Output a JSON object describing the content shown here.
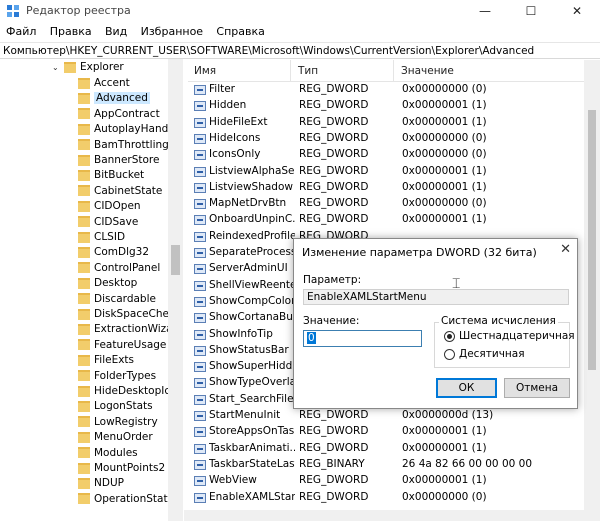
{
  "window": {
    "title": "Редактор реестра",
    "minimize": "—",
    "maximize": "☐",
    "close": "✕"
  },
  "menu": [
    "Файл",
    "Правка",
    "Вид",
    "Избранное",
    "Справка"
  ],
  "address": "Компьютер\\HKEY_CURRENT_USER\\SOFTWARE\\Microsoft\\Windows\\CurrentVersion\\Explorer\\Advanced",
  "tree": {
    "parent": "Explorer",
    "children": [
      "Accent",
      "Advanced",
      "AppContract",
      "AutoplayHandle",
      "BamThrottling",
      "BannerStore",
      "BitBucket",
      "CabinetState",
      "CIDOpen",
      "CIDSave",
      "CLSID",
      "ComDlg32",
      "ControlPanel",
      "Desktop",
      "Discardable",
      "DiskSpaceCheck",
      "ExtractionWizard",
      "FeatureUsage",
      "FileExts",
      "FolderTypes",
      "HideDesktopIco",
      "LogonStats",
      "LowRegistry",
      "MenuOrder",
      "Modules",
      "MountPoints2",
      "NDUP",
      "OperationStatus"
    ],
    "selected": "Advanced"
  },
  "columns": {
    "name": "Имя",
    "type": "Тип",
    "data": "Значение"
  },
  "values": [
    {
      "name": "Filter",
      "type": "REG_DWORD",
      "data": "0x00000000 (0)"
    },
    {
      "name": "Hidden",
      "type": "REG_DWORD",
      "data": "0x00000001 (1)"
    },
    {
      "name": "HideFileExt",
      "type": "REG_DWORD",
      "data": "0x00000001 (1)"
    },
    {
      "name": "HideIcons",
      "type": "REG_DWORD",
      "data": "0x00000000 (0)"
    },
    {
      "name": "IconsOnly",
      "type": "REG_DWORD",
      "data": "0x00000000 (0)"
    },
    {
      "name": "ListviewAlphaSe...",
      "type": "REG_DWORD",
      "data": "0x00000001 (1)"
    },
    {
      "name": "ListviewShadow",
      "type": "REG_DWORD",
      "data": "0x00000001 (1)"
    },
    {
      "name": "MapNetDrvBtn",
      "type": "REG_DWORD",
      "data": "0x00000000 (0)"
    },
    {
      "name": "OnboardUnpinC...",
      "type": "REG_DWORD",
      "data": "0x00000001 (1)"
    },
    {
      "name": "ReindexedProfile",
      "type": "REG_DWORD",
      "data": ""
    },
    {
      "name": "SeparateProcess",
      "type": "",
      "data": ""
    },
    {
      "name": "ServerAdminUI",
      "type": "",
      "data": ""
    },
    {
      "name": "ShellViewReente...",
      "type": "",
      "data": ""
    },
    {
      "name": "ShowCompColor",
      "type": "",
      "data": ""
    },
    {
      "name": "ShowCortanaBu...",
      "type": "",
      "data": ""
    },
    {
      "name": "ShowInfoTip",
      "type": "",
      "data": ""
    },
    {
      "name": "ShowStatusBar",
      "type": "",
      "data": ""
    },
    {
      "name": "ShowSuperHidd...",
      "type": "",
      "data": ""
    },
    {
      "name": "ShowTypeOverlay",
      "type": "",
      "data": ""
    },
    {
      "name": "Start_SearchFiles",
      "type": "",
      "data": ""
    },
    {
      "name": "StartMenuInit",
      "type": "REG_DWORD",
      "data": "0x0000000d (13)"
    },
    {
      "name": "StoreAppsOnTas...",
      "type": "REG_DWORD",
      "data": "0x00000001 (1)"
    },
    {
      "name": "TaskbarAnimati...",
      "type": "REG_DWORD",
      "data": "0x00000001 (1)"
    },
    {
      "name": "TaskbarStateLast...",
      "type": "REG_BINARY",
      "data": "26 4a 82 66 00 00 00 00"
    },
    {
      "name": "WebView",
      "type": "REG_DWORD",
      "data": "0x00000001 (1)"
    },
    {
      "name": "EnableXAMLStar...",
      "type": "REG_DWORD",
      "data": "0x00000000 (0)"
    }
  ],
  "dialog": {
    "title": "Изменение параметра DWORD (32 бита)",
    "close": "✕",
    "param_label": "Параметр:",
    "param_value": "EnableXAMLStartMenu",
    "value_label": "Значение:",
    "value": "0",
    "base_label": "Система исчисления",
    "hex_label": "Шестнадцатеричная",
    "dec_label": "Десятичная",
    "ok": "ОК",
    "cancel": "Отмена"
  }
}
